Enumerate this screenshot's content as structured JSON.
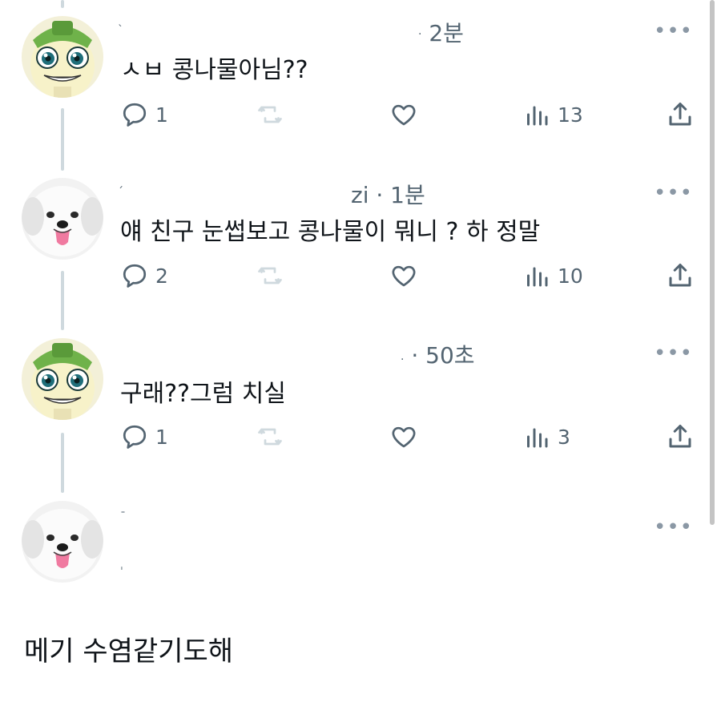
{
  "tweets": [
    {
      "avatar": "green-hat-character-avatar",
      "handle_suffix": "2분",
      "text": "ㅅㅂ 콩나물아님??",
      "reply_count": "1",
      "view_count": "13"
    },
    {
      "avatar": "white-dog-avatar",
      "handle_suffix": "zi · 1분",
      "text": "얘 친구 눈썹보고 콩나물이 뭐니 ? 하 정말",
      "reply_count": "2",
      "view_count": "10"
    },
    {
      "avatar": "green-hat-character-avatar",
      "handle_suffix": "· 50초",
      "text": "구래??그럼 치실",
      "reply_count": "1",
      "view_count": "3"
    },
    {
      "avatar": "white-dog-avatar",
      "handle_suffix": "",
      "text": ""
    }
  ],
  "more_label": "•••",
  "reply_text": "메기 수염같기도해",
  "icons": [
    "reply-icon",
    "retweet-icon",
    "like-icon",
    "views-icon",
    "share-icon",
    "more-icon"
  ],
  "colors": {
    "text": "#0f1419",
    "secondary": "#536471",
    "line": "#cfd9de",
    "muted_icon": "#cfd9de"
  }
}
